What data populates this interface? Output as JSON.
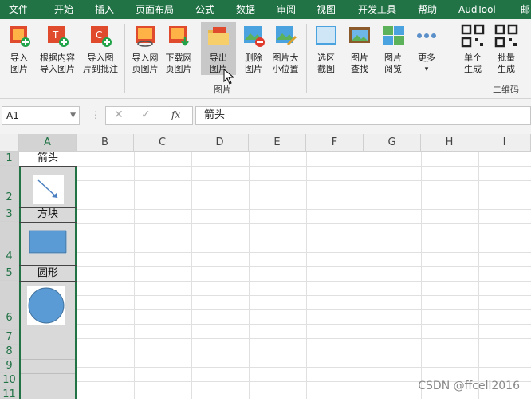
{
  "menu": {
    "tabs": [
      "文件",
      "开始",
      "插入",
      "页面布局",
      "公式",
      "数据",
      "审阅",
      "视图",
      "开发工具",
      "帮助",
      "AudTool",
      "邮"
    ]
  },
  "ribbon": {
    "buttons": [
      {
        "line1": "导入",
        "line2": "图片"
      },
      {
        "line1": "根据内容",
        "line2": "导入图片"
      },
      {
        "line1": "导入图",
        "line2": "片到批注"
      },
      {
        "line1": "导入网",
        "line2": "页图片"
      },
      {
        "line1": "下载网",
        "line2": "页图片"
      },
      {
        "line1": "导出",
        "line2": "图片"
      },
      {
        "line1": "删除",
        "line2": "图片"
      },
      {
        "line1": "图片大",
        "line2": "小位置"
      },
      {
        "line1": "选区",
        "line2": "截图"
      },
      {
        "line1": "图片",
        "line2": "查找"
      },
      {
        "line1": "图片",
        "line2": "阅览"
      },
      {
        "line1": "更多",
        "line2": "▾"
      },
      {
        "line1": "单个",
        "line2": "生成"
      },
      {
        "line1": "批量",
        "line2": "生成"
      }
    ],
    "group_images": "图片",
    "group_qrcode": "二维码"
  },
  "formula_bar": {
    "name_box": "A1",
    "fx": "fx",
    "content": "箭头"
  },
  "sheet": {
    "columns": [
      "A",
      "B",
      "C",
      "D",
      "E",
      "F",
      "G",
      "H",
      "I"
    ],
    "rows": [
      "1",
      "2",
      "3",
      "4",
      "5",
      "6",
      "7",
      "8",
      "9",
      "10",
      "11"
    ],
    "cell_texts": {
      "a1": "箭头",
      "a3": "方块",
      "a5": "圆形"
    },
    "shape_color": "#5b9bd5"
  },
  "watermark": "CSDN @ffcell2016"
}
